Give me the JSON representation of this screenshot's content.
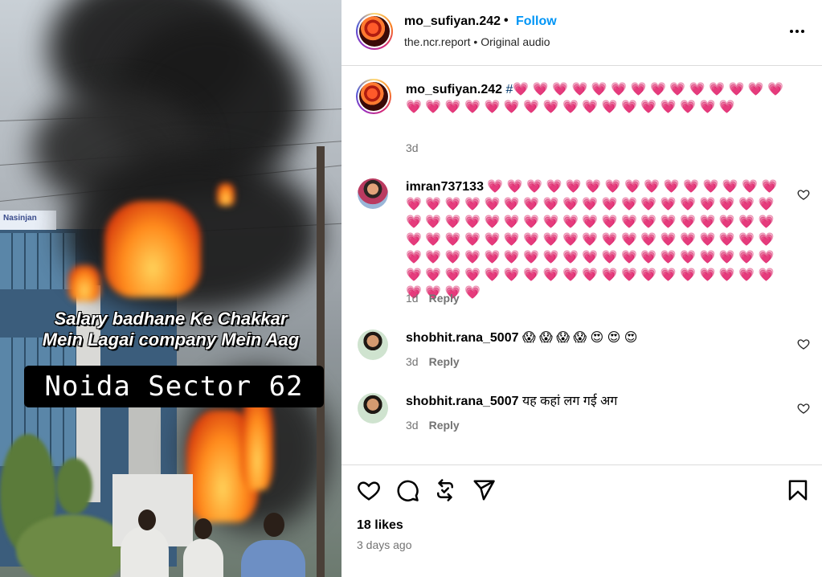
{
  "post": {
    "username": "mo_sufiyan.242",
    "dot": "•",
    "follow_label": "Follow",
    "source": "the.ncr.report",
    "sub_dot": "•",
    "audio": "Original audio"
  },
  "media": {
    "caption_line1": "Salary badhane Ke Chakkar",
    "caption_line2": "Mein Lagai company Mein Aag",
    "label": "Noida Sector 62",
    "sign_text": "Nasinjan"
  },
  "comments": [
    {
      "username": "mo_sufiyan.242",
      "hashtag": "#",
      "text": "💗 💗 💗 💗 💗 💗 💗 💗 💗 💗 💗 💗 💗 💗 💗 💗 💗 💗 💗 💗 💗 💗 💗 💗 💗 💗 💗 💗 💗 💗 💗",
      "time": "3d",
      "reply": ""
    },
    {
      "username": "imran737133",
      "text": "💗 💗 💗 💗 💗 💗 💗 💗 💗 💗 💗 💗 💗 💗 💗 💗 💗 💗 💗 💗 💗 💗 💗 💗 💗 💗 💗 💗 💗 💗 💗 💗 💗 💗 💗 💗 💗 💗 💗 💗 💗 💗 💗 💗 💗 💗 💗 💗 💗 💗 💗 💗 💗 💗 💗 💗 💗 💗 💗 💗 💗 💗 💗 💗 💗 💗 💗 💗 💗 💗 💗 💗 💗 💗 💗 💗 💗 💗 💗 💗 💗 💗 💗 💗 💗 💗 💗 💗 💗 💗 💗 💗 💗 💗 💗 💗 💗 💗 💗 💗 💗 💗 💗 💗 💗 💗 💗 💗 💗 💗 💗 💗 💗 💗",
      "time": "1d",
      "reply": "Reply"
    },
    {
      "username": "shobhit.rana_5007",
      "text": "😱 😱 😱 😱 😍 😍 😍",
      "time": "3d",
      "reply": "Reply"
    },
    {
      "username": "shobhit.rana_5007",
      "text": "यह कहां लग गई अग",
      "time": "3d",
      "reply": "Reply"
    }
  ],
  "footer": {
    "likes": "18 likes",
    "time_ago": "3 days ago"
  },
  "icons": {
    "like": "heart-icon",
    "comment": "comment-icon",
    "share": "repost-icon",
    "send": "send-icon",
    "save": "bookmark-icon",
    "more": "more-options-icon"
  }
}
